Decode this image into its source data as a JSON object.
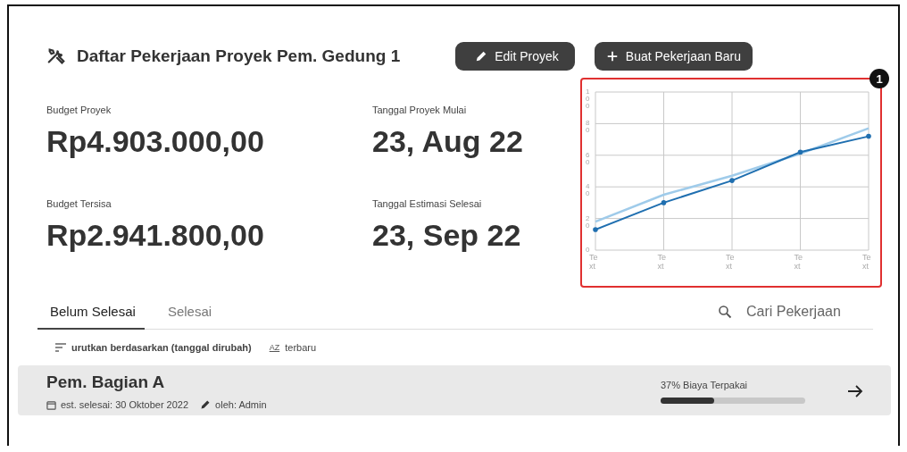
{
  "header": {
    "title": "Daftar Pekerjaan Proyek Pem. Gedung 1",
    "buttons": [
      {
        "kind": "edit",
        "label": "Edit Proyek"
      },
      {
        "kind": "add",
        "label": "Buat Pekerjaan Baru"
      }
    ]
  },
  "stats": [
    {
      "label": "Budget Proyek",
      "value": "Rp4.903.000,00"
    },
    {
      "label": "Tanggal Proyek Mulai",
      "value": "23, Aug 22"
    },
    {
      "label": "Budget Tersisa",
      "value": "Rp2.941.800,00"
    },
    {
      "label": "Tanggal Estimasi Selesai",
      "value": "23, Sep 22"
    }
  ],
  "chart": {
    "badge": "1",
    "chart_data": {
      "type": "line",
      "grid": true,
      "categories": [
        "Text",
        "Text",
        "Text",
        "Text",
        "Text"
      ],
      "ylim": [
        0,
        100
      ],
      "yticks": [
        0,
        20,
        40,
        60,
        80,
        100
      ],
      "series": [
        {
          "color": "#9fcbea",
          "values": [
            18,
            35,
            47,
            61,
            77
          ]
        },
        {
          "color": "#1f6fb0",
          "values": [
            13,
            30,
            44,
            62,
            72
          ]
        }
      ]
    }
  },
  "tabs": [
    {
      "label": "Belum Selesai",
      "selected": true
    },
    {
      "label": "Selesai",
      "selected": false
    }
  ],
  "search": {
    "placeholder": "Cari Pekerjaan"
  },
  "sort": {
    "label": "urutkan berdasarkan (tanggal dirubah)",
    "order_glyph": "AZ",
    "order": "terbaru"
  },
  "tasks": [
    {
      "name": "Pem. Bagian A",
      "due": "est. selesai: 30 Oktober 2022",
      "author": "oleh: Admin",
      "usage": "37% Biaya Terpakai",
      "level": 0.37
    }
  ]
}
